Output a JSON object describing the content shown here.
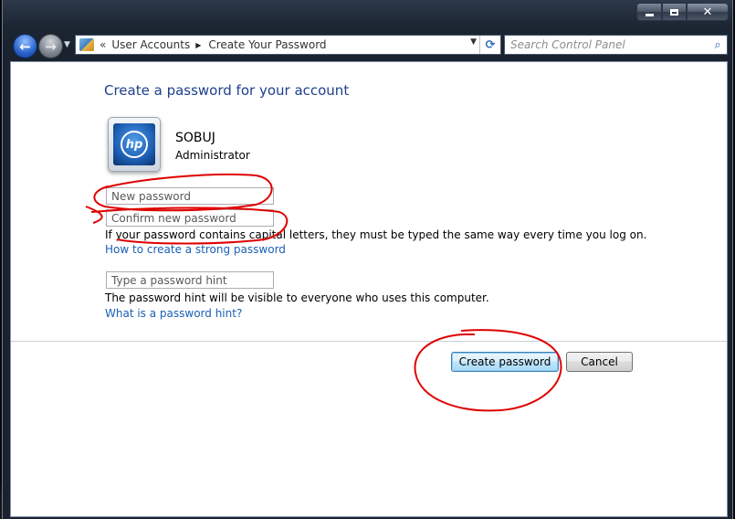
{
  "window": {
    "caption_buttons": {
      "minimize": "minimize-icon",
      "maximize": "maximize-icon",
      "close": "✕"
    }
  },
  "nav": {
    "back_icon": "←",
    "forward_icon": "→",
    "dropdown_icon": "▼"
  },
  "address_bar": {
    "chevron": "«",
    "items": [
      "User Accounts",
      "Create Your Password"
    ],
    "separator": "▶",
    "dropdown_icon": "▼",
    "refresh_icon": "⟳"
  },
  "search": {
    "placeholder": "Search Control Panel",
    "icon": "⌕"
  },
  "page": {
    "title": "Create a password for your account",
    "user": {
      "name": "SOBUJ",
      "role": "Administrator",
      "avatar_logo": "hp"
    },
    "fields": {
      "new_password_placeholder": "New password",
      "confirm_password_placeholder": "Confirm new password",
      "hint_placeholder": "Type a password hint"
    },
    "capital_note": "If your password contains capital letters, they must be typed the same way every time you log on.",
    "strong_password_link": "How to create a strong password",
    "hint_note": "The password hint will be visible to everyone who uses this computer.",
    "hint_link": "What is a password hint?",
    "buttons": {
      "create": "Create password",
      "cancel": "Cancel"
    }
  },
  "colors": {
    "title": "#1e3f8c",
    "link": "#1a5fb4",
    "annotation": "#e00000"
  }
}
